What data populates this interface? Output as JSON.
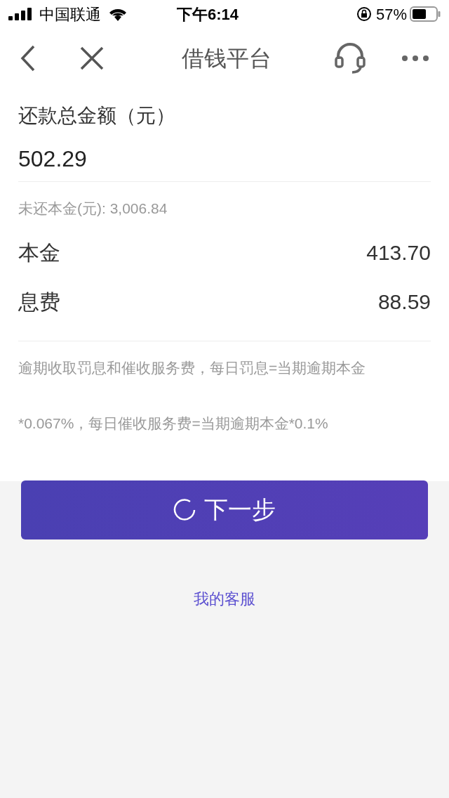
{
  "status_bar": {
    "carrier": "中国联通",
    "time": "下午6:14",
    "battery": "57%"
  },
  "nav": {
    "title": "借钱平台"
  },
  "total": {
    "label": "还款总金额（元）",
    "value": "502.29"
  },
  "remaining": "未还本金(元): 3,006.84",
  "rows": [
    {
      "label": "本金",
      "value": "413.70"
    },
    {
      "label": "息费",
      "value": "88.59"
    }
  ],
  "notes": [
    "逾期收取罚息和催收服务费，每日罚息=当期逾期本金",
    "*0.067%，每日催收服务费=当期逾期本金*0.1%"
  ],
  "next_button": {
    "label": "下一步",
    "loading": true
  },
  "service_link": "我的客服"
}
